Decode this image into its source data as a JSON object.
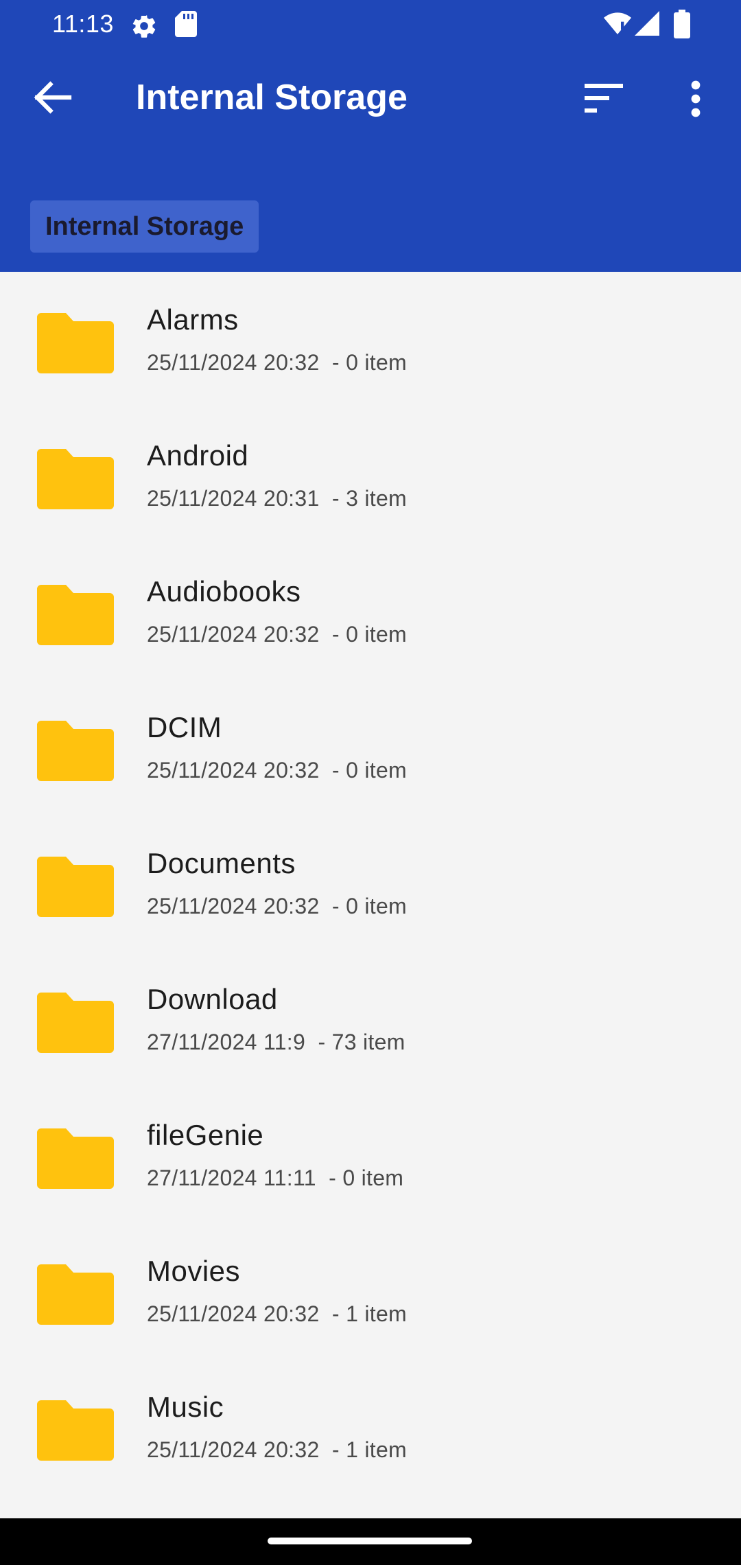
{
  "status_bar": {
    "time": "11:13",
    "icons": [
      "gear-icon",
      "sd-card-icon",
      "wifi-icon",
      "signal-icon",
      "battery-icon"
    ]
  },
  "app_bar": {
    "title": "Internal Storage",
    "back_icon": "arrow-left-icon",
    "sort_icon": "sort-icon",
    "more_icon": "more-vert-icon"
  },
  "breadcrumb": {
    "label": "Internal Storage"
  },
  "colors": {
    "header": "#1f47b8",
    "chip": "#3f63cc",
    "folder": "#ffc20e",
    "background": "#f4f4f4"
  },
  "folders": [
    {
      "name": "Alarms",
      "meta": "25/11/2024 20:32  - 0 item"
    },
    {
      "name": "Android",
      "meta": "25/11/2024 20:31  - 3 item"
    },
    {
      "name": "Audiobooks",
      "meta": "25/11/2024 20:32  - 0 item"
    },
    {
      "name": "DCIM",
      "meta": "25/11/2024 20:32  - 0 item"
    },
    {
      "name": "Documents",
      "meta": "25/11/2024 20:32  - 0 item"
    },
    {
      "name": "Download",
      "meta": "27/11/2024 11:9  - 73 item"
    },
    {
      "name": "fileGenie",
      "meta": "27/11/2024 11:11  - 0 item"
    },
    {
      "name": "Movies",
      "meta": "25/11/2024 20:32  - 1 item"
    },
    {
      "name": "Music",
      "meta": "25/11/2024 20:32  - 1 item"
    }
  ]
}
